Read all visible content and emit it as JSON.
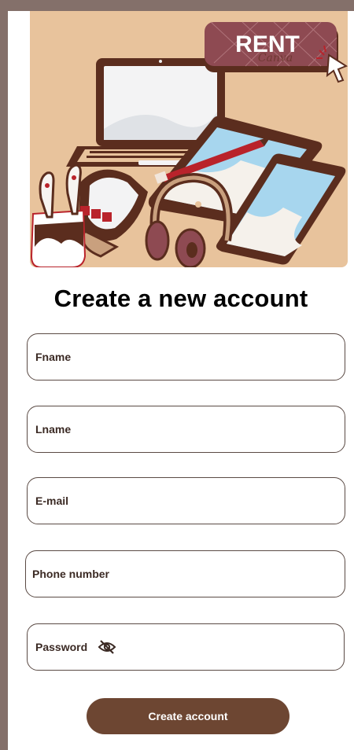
{
  "hero": {
    "badge_text": "RENT",
    "badge_watermark": "Canva",
    "illustration_icons": [
      "laptop-icon",
      "tablet-icon",
      "phone-icon",
      "smartwatch-icon",
      "headphones-icon",
      "earbuds-icon",
      "stylus-icon",
      "cursor-icon"
    ]
  },
  "form": {
    "title": "Create a new account",
    "fname_placeholder": "Fname",
    "lname_placeholder": "Lname",
    "email_placeholder": "E-mail",
    "phone_placeholder": "Phone number",
    "password_placeholder": "Password",
    "password_toggle_icon": "eye-off-icon",
    "submit_label": "Create account"
  },
  "colors": {
    "frame_background": "#84706a",
    "hero_background": "#e8c39c",
    "accent_brown": "#6d4632",
    "badge_red": "#8e4a52",
    "text_dark": "#3b2a24"
  }
}
